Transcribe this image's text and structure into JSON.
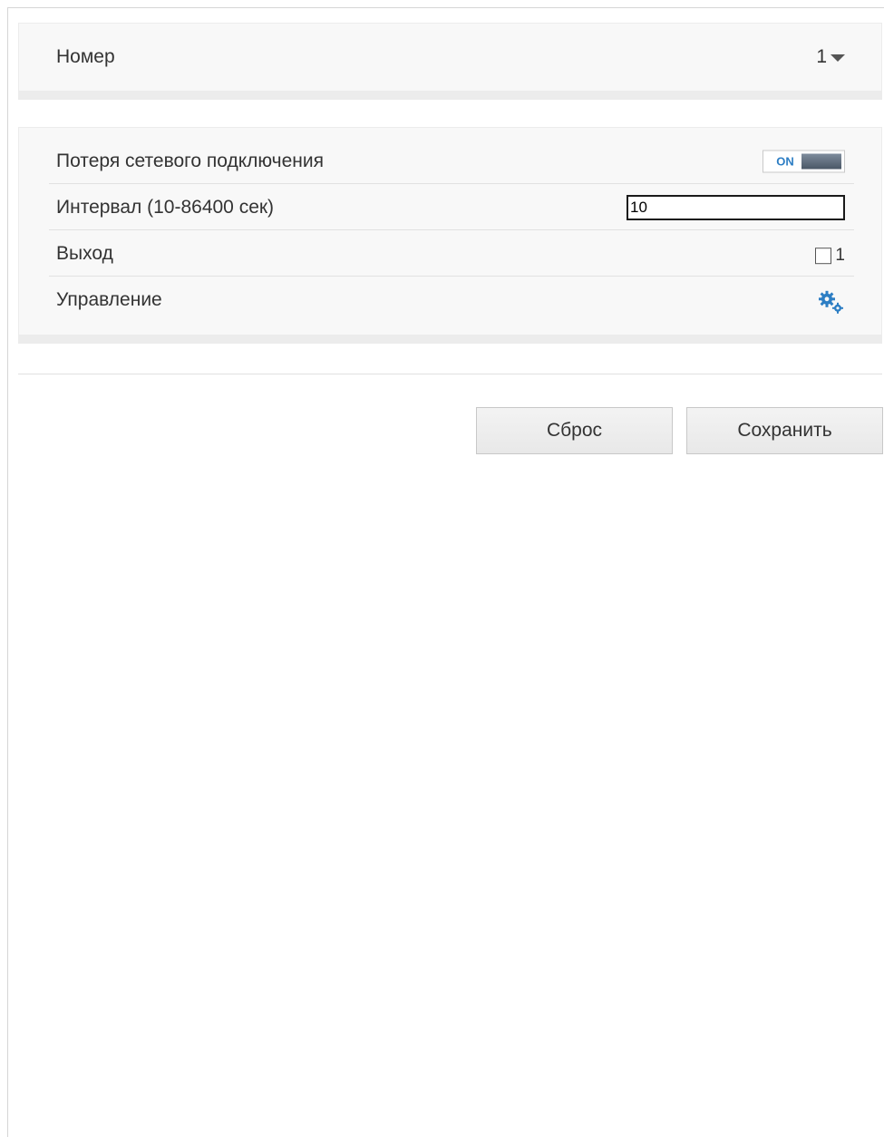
{
  "number_panel": {
    "label": "Номер",
    "value": "1"
  },
  "settings_panel": {
    "network_loss": {
      "label": "Потеря сетевого подключения",
      "toggle_text": "ON",
      "enabled": true
    },
    "interval": {
      "label": "Интервал (10-86400 сек)",
      "value": "10"
    },
    "output": {
      "label": "Выход",
      "checkbox_label": "1",
      "checked": false
    },
    "control": {
      "label": "Управление",
      "icon": "gears-icon"
    }
  },
  "buttons": {
    "reset_label": "Сброс",
    "save_label": "Сохранить"
  },
  "colors": {
    "accent": "#2d7ec4",
    "panel_bg": "#f8f8f8"
  }
}
